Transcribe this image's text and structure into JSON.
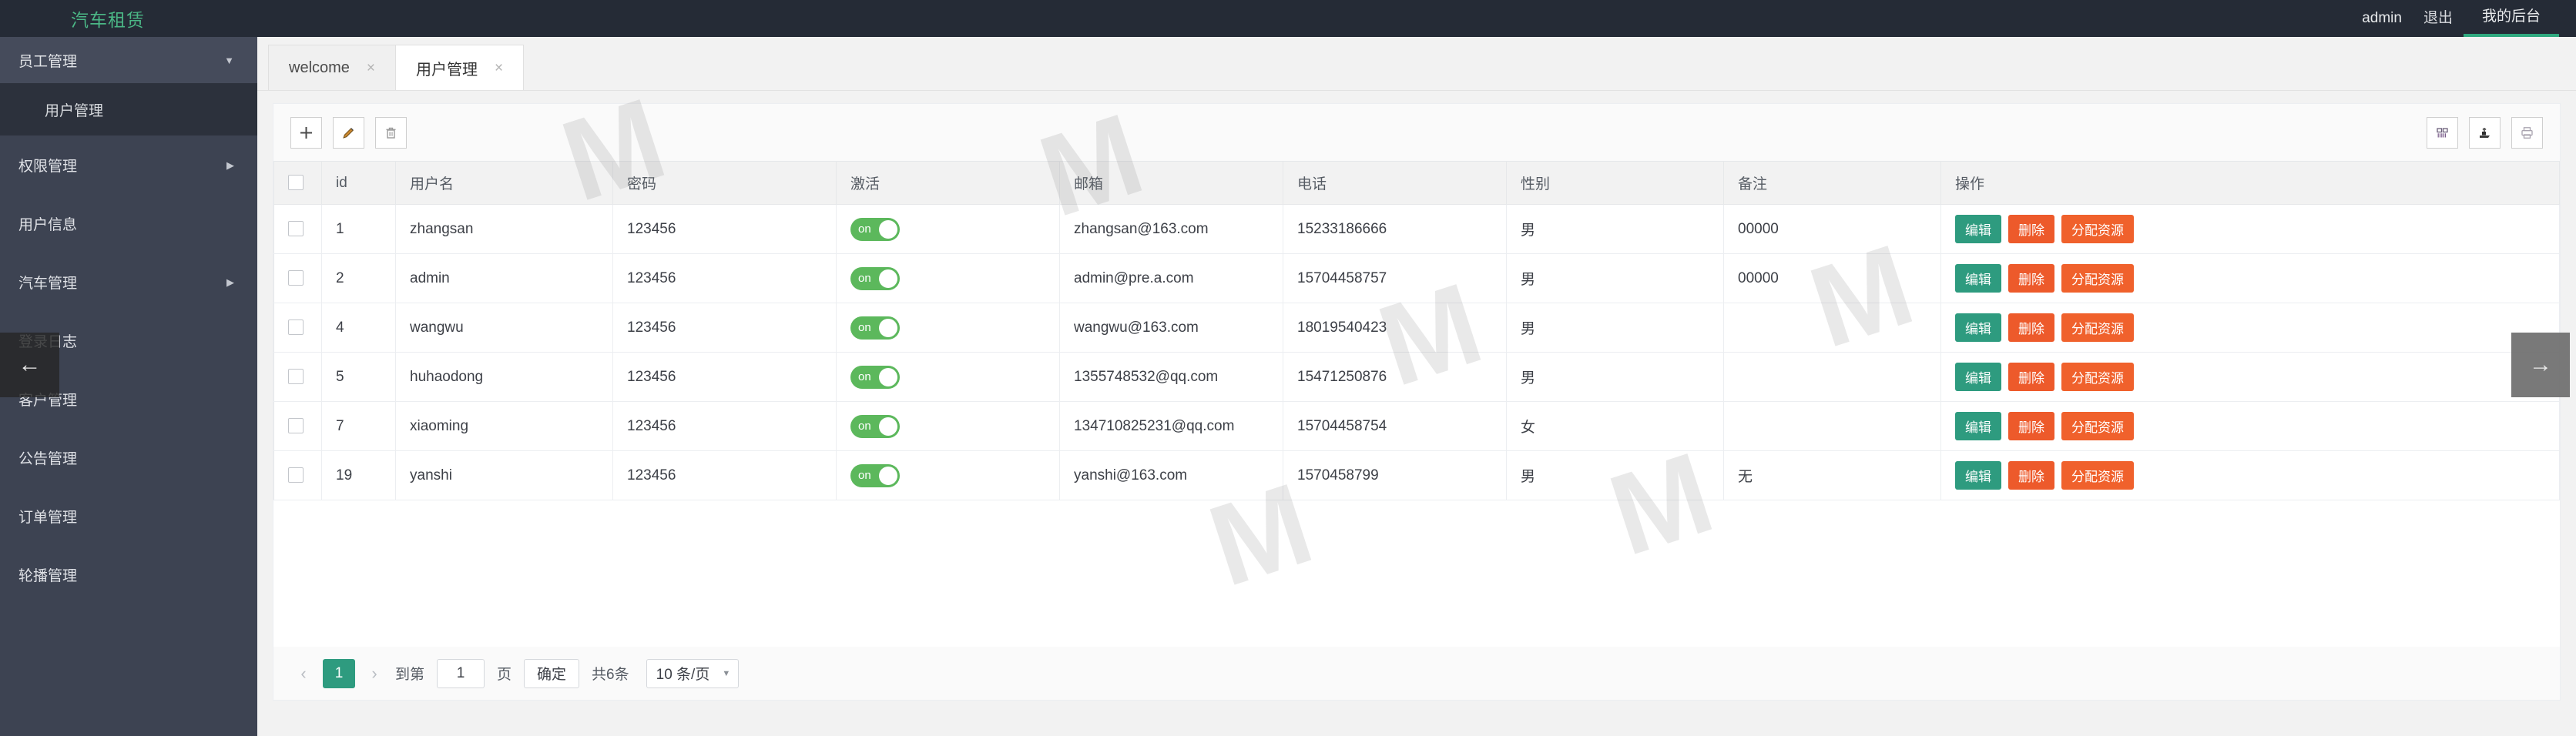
{
  "topbar": {
    "brand": "汽车租赁",
    "user": "admin",
    "logout": "退出",
    "my_console": "我的后台",
    "accent": "#2fa97f"
  },
  "sidebar": {
    "items": [
      {
        "label": "员工管理",
        "type": "group",
        "expanded": true,
        "caret": "caret-down-icon"
      },
      {
        "label": "用户管理",
        "type": "sub",
        "active": true
      },
      {
        "label": "权限管理",
        "type": "item",
        "caret": "caret-right-icon"
      },
      {
        "label": "用户信息",
        "type": "item",
        "caret": ""
      },
      {
        "label": "汽车管理",
        "type": "item",
        "caret": "caret-right-icon"
      },
      {
        "label": "登录日志",
        "type": "item",
        "caret": ""
      },
      {
        "label": "客户管理",
        "type": "item",
        "caret": ""
      },
      {
        "label": "公告管理",
        "type": "item",
        "caret": ""
      },
      {
        "label": "订单管理",
        "type": "item",
        "caret": ""
      },
      {
        "label": "轮播管理",
        "type": "item",
        "caret": ""
      }
    ]
  },
  "overlay": {
    "prev_arrow": "←",
    "next_arrow": "→"
  },
  "tabs": [
    {
      "label": "welcome",
      "active": false,
      "close": "×"
    },
    {
      "label": "用户管理",
      "active": true,
      "close": "×"
    }
  ],
  "toolbar": {
    "add": "+",
    "edit": "✎",
    "delete": "🗑",
    "columns": "columns-icon",
    "export": "export-icon",
    "print": "print-icon"
  },
  "table": {
    "columns": [
      "",
      "id",
      "用户名",
      "密码",
      "激活",
      "邮箱",
      "电话",
      "性别",
      "备注",
      "操作"
    ],
    "rows": [
      {
        "id": "1",
        "username": "zhangsan",
        "password": "123456",
        "active": "on",
        "email": "zhangsan@163.com",
        "phone": "15233186666",
        "gender": "男",
        "remark": "00000"
      },
      {
        "id": "2",
        "username": "admin",
        "password": "123456",
        "active": "on",
        "email": "admin@pre.a.com",
        "phone": "15704458757",
        "gender": "男",
        "remark": "00000"
      },
      {
        "id": "4",
        "username": "wangwu",
        "password": "123456",
        "active": "on",
        "email": "wangwu@163.com",
        "phone": "18019540423",
        "gender": "男",
        "remark": ""
      },
      {
        "id": "5",
        "username": "huhaodong",
        "password": "123456",
        "active": "on",
        "email": "1355748532@qq.com",
        "phone": "15471250876",
        "gender": "男",
        "remark": ""
      },
      {
        "id": "7",
        "username": "xiaoming",
        "password": "123456",
        "active": "on",
        "email": "134710825231@qq.com",
        "phone": "15704458754",
        "gender": "女",
        "remark": ""
      },
      {
        "id": "19",
        "username": "yanshi",
        "password": "123456",
        "active": "on",
        "email": "yanshi@163.com",
        "phone": "1570458799",
        "gender": "男",
        "remark": "无"
      }
    ],
    "actions": {
      "edit": "编辑",
      "delete": "删除",
      "assign": "分配资源"
    }
  },
  "pagination": {
    "prev": "‹",
    "next": "›",
    "current_page": "1",
    "goto_prefix": "到第",
    "goto_value": "1",
    "goto_suffix": "页",
    "confirm": "确定",
    "total": "共6条",
    "page_size": "10 条/页",
    "dropdown": "▼"
  },
  "watermark": {
    "text": "M"
  }
}
